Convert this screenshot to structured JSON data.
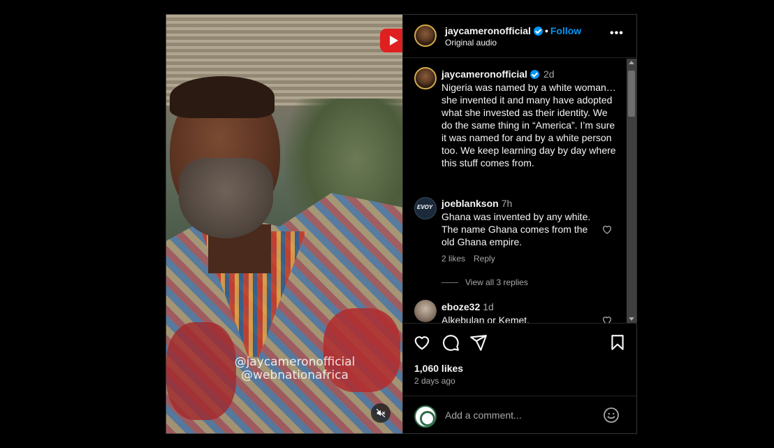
{
  "post": {
    "author": "jaycameronofficial",
    "separator": "•",
    "follow_label": "Follow",
    "audio": "Original audio",
    "more_label": "•••",
    "video_overlay": [
      "@jaycameronofficial",
      "@webnationafrica"
    ]
  },
  "caption": {
    "author": "jaycameronofficial",
    "time": "2d",
    "text": "Nigeria was named by a white woman… she invented it and many have adopted what she invested as their identity. We do the same thing in “America”. I’m sure it was named for and by a white person too. We keep learning day by day where this stuff comes from."
  },
  "comments": [
    {
      "author": "joeblankson",
      "avatar_text": "EVOY",
      "time": "7h",
      "text": "Ghana was invented by any white. The name Ghana comes from the old Ghana empire.",
      "likes": "2 likes",
      "reply_label": "Reply",
      "view_replies": "View all 3 replies"
    },
    {
      "author": "eboze32",
      "time": "1d",
      "text": "Alkebulan or Kemet."
    }
  ],
  "stats": {
    "likes": "1,060 likes",
    "ago": "2 days ago"
  },
  "composer": {
    "placeholder": "Add a comment..."
  },
  "colors": {
    "accent": "#0095f6",
    "background": "#000000",
    "secondary_text": "#a8a8a8"
  },
  "icons": [
    "verified-badge-icon",
    "more-options-icon",
    "heart-icon",
    "comment-icon",
    "share-icon",
    "bookmark-icon",
    "emoji-icon",
    "mute-icon",
    "youtube-logo-icon"
  ]
}
